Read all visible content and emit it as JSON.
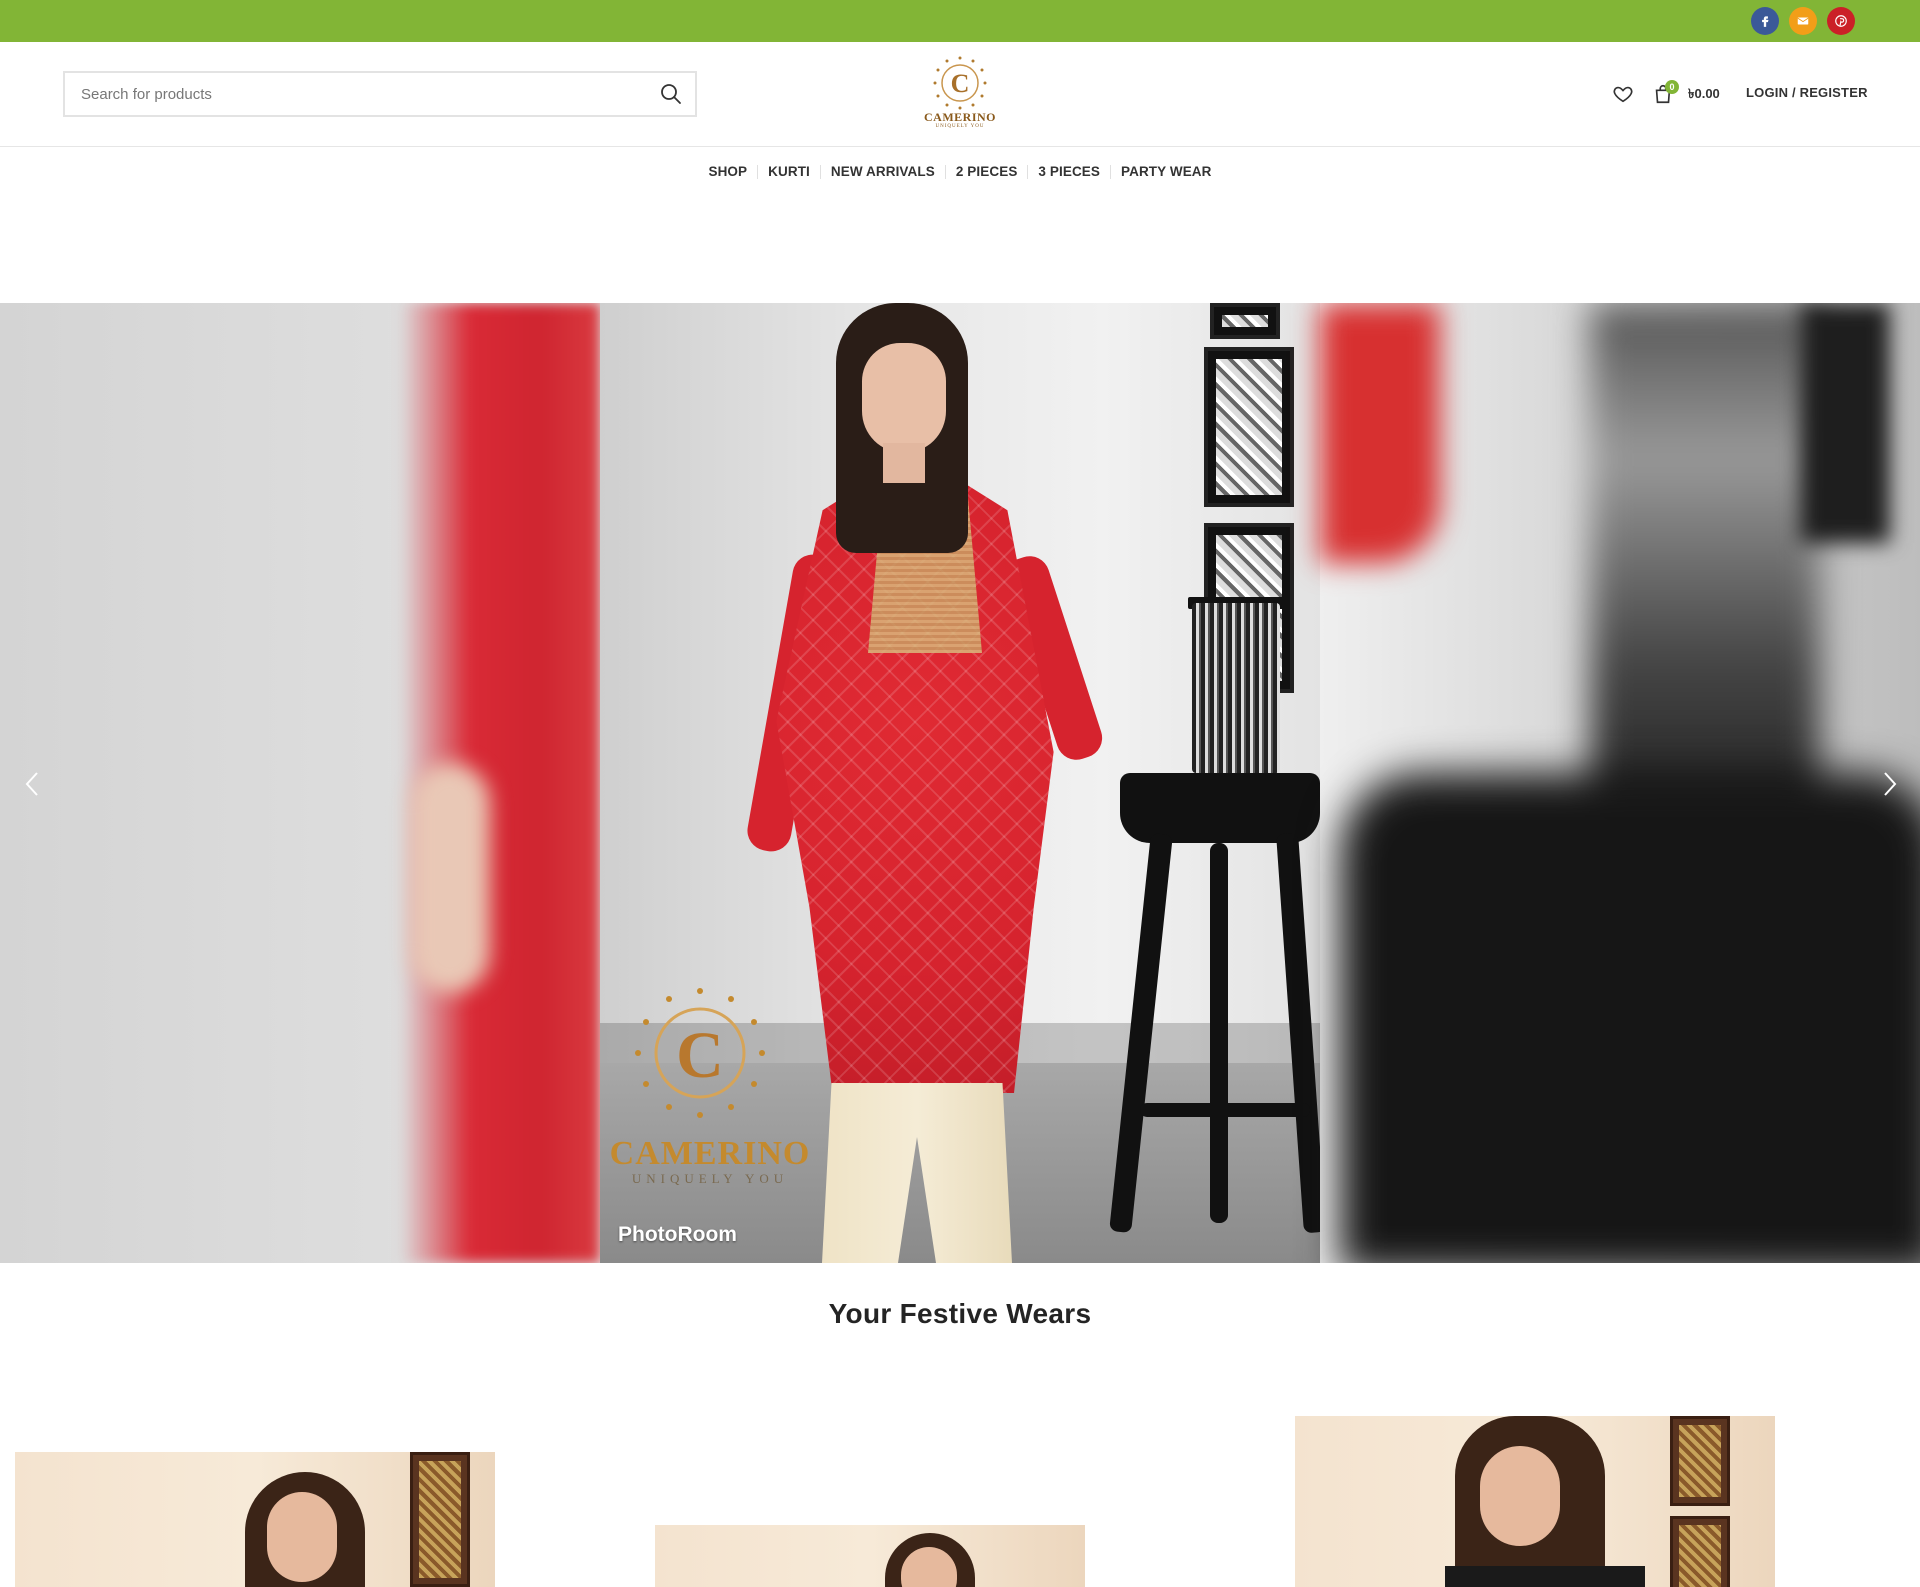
{
  "topbar": {
    "accent_color": "#82b536",
    "social": [
      {
        "name": "facebook-icon",
        "color": "#3b5998"
      },
      {
        "name": "email-icon",
        "color": "#f29e18"
      },
      {
        "name": "pinterest-icon",
        "color": "#cb2027"
      }
    ]
  },
  "header": {
    "search": {
      "placeholder": "Search for products"
    },
    "logo": {
      "title": "CAMERINO",
      "tagline": "UNIQUELY YOU"
    },
    "cart": {
      "count": "0",
      "total": "৳0.00"
    },
    "login_label": "LOGIN / REGISTER"
  },
  "nav": {
    "items": [
      "SHOP",
      "KURTI",
      "NEW ARRIVALS",
      "2 PIECES",
      "3 PIECES",
      "PARTY WEAR"
    ]
  },
  "slider": {
    "watermark_title": "CAMERINO",
    "watermark_tagline": "UNIQUELY YOU",
    "photoroom_label": "PhotoRoom"
  },
  "section": {
    "title": "Your Festive Wears"
  }
}
